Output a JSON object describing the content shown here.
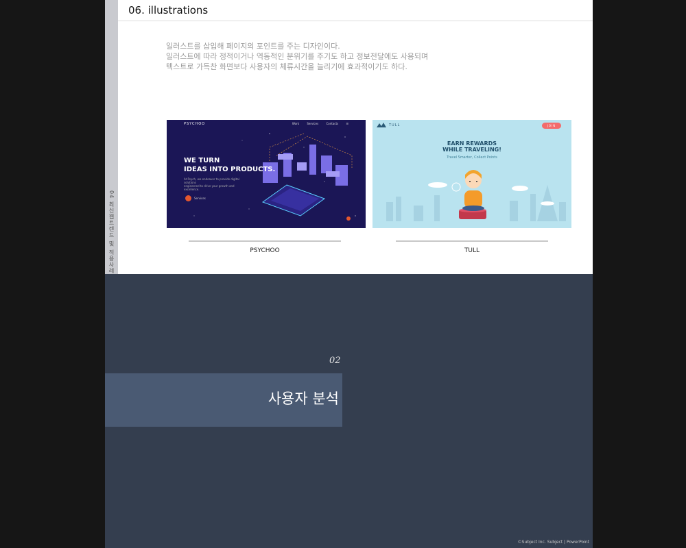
{
  "slide": {
    "side_label": "04 최신웹트렌드 및 적용사례",
    "title": "06. illustrations",
    "description": [
      "일러스트를 삽입해 페이지의 포인트를 주는 디자인이다.",
      "일러스트에 따라 정적이거나 역동적인 분위기를 주기도 하고 정보전달에도 사용되며",
      "텍스트로 가득찬 화면보다 사용자의 체류시간을 늘리기에 효과적이기도 하다."
    ],
    "cards": [
      {
        "caption": "PSYCHOO",
        "brand": "PSYCHOO",
        "nav": [
          "Work",
          "Services",
          "Contacts",
          "☰"
        ],
        "headline_1": "WE TURN",
        "headline_2": "IDEAS INTO PRODUCTS.",
        "sub_1": "At Psych, we endeavor to provide digital solutions",
        "sub_2": "engineered to drive your growth and excellence.",
        "button_label": "Services",
        "bg_color": "#1b1656",
        "accent_color": "#e4572e"
      },
      {
        "caption": "TULL",
        "brand": "TULL",
        "join_label": "JOIN",
        "headline_1": "EARN REWARDS",
        "headline_2": "WHILE TRAVELING!",
        "sub": "Travel Smarter, Collect Points",
        "bg_color": "#b9e3ef",
        "accent_color": "#f36c6c"
      }
    ]
  },
  "section": {
    "number": "02",
    "title": "사용자 분석",
    "copyright": "©Subject Inc. Subject | PowerPoint"
  },
  "colors": {
    "dark_panel": "#343e4f",
    "band": "#4a5a73",
    "frame": "#161616"
  }
}
